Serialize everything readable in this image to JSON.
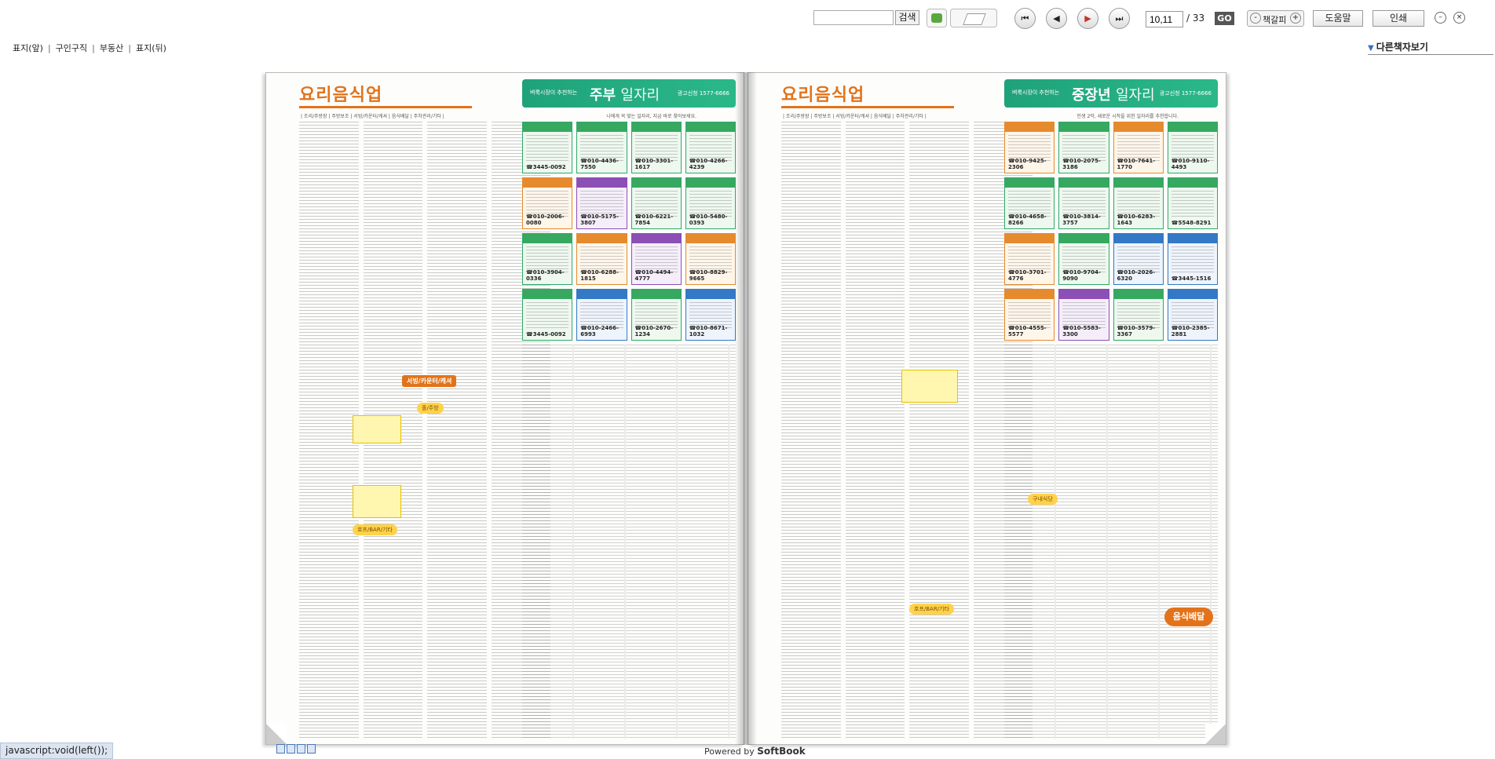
{
  "toolbar": {
    "search_placeholder": "",
    "search_label": "검색",
    "first_symbol": "⏮",
    "prev_symbol": "◀",
    "next_symbol": "▶",
    "last_symbol": "⏭",
    "page_value": "10,11",
    "page_total": "/ 33",
    "go_label": "GO",
    "zoom_minus": "-",
    "zoom_label": "책갈피",
    "zoom_plus": "+",
    "help_label": "도움말",
    "print_label": "인쇄",
    "minimize_symbol": "–",
    "close_symbol": "×"
  },
  "nav": {
    "links": [
      "표지(앞)",
      "구인구직",
      "부동산",
      "표지(뒤)"
    ],
    "other_books_label": "다른책자보기"
  },
  "left_page": {
    "title": "요리음식업",
    "sub_tabs": "| 조리/주방장 | 주방보조 | 서빙/카운터/캐셔 | 음식배달 | 주차관리/기타 |",
    "banner_small": "벼룩시장이 추천하는",
    "banner_big": "주부",
    "banner_big_light": "일자리",
    "banner_phone": "광고신청 1577-6666",
    "banner_sub": "나에게 꼭 맞는 일자리, 지금 바로 찾아보세요.",
    "label_serving": "서빙/카운터/캐셔",
    "label_hall": "홀/주방",
    "label_bar": "호프/BAR/기타",
    "box_phones": [
      "☎3445-0092",
      "☎010-4436-7550",
      "☎010-3301-1617",
      "☎010-4266-4239",
      "☎010-2006-0080",
      "☎010-5175-3807",
      "☎010-6221-7854",
      "☎010-5480-0393",
      "☎010-3904-0336",
      "☎010-6288-1815",
      "☎010-4494-4777",
      "☎010-8829-9665",
      "☎3445-0092",
      "☎010-2466-6993",
      "☎010-2670-1234",
      "☎010-8671-1032"
    ]
  },
  "right_page": {
    "title": "요리음식업",
    "sub_tabs": "| 조리/주방장 | 주방보조 | 서빙/카운터/캐셔 | 음식배달 | 주차관리/기타 |",
    "banner_small": "벼룩시장이 추천하는",
    "banner_big": "중장년",
    "banner_big_light": "일자리",
    "banner_phone": "광고신청 1577-6666",
    "banner_sub": "인생 2막, 새로운 시작을 위한 일자리를 추천합니다.",
    "label_kitchen": "구내식당",
    "label_bar": "호프/BAR/기타",
    "label_delivery": "음식배달",
    "box_phones": [
      "☎010-9425-2306",
      "☎010-2075-3186",
      "☎010-7641-1770",
      "☎010-9110-4493",
      "☎010-4658-8266",
      "☎010-3814-3757",
      "☎010-6283-1643",
      "☎5548-8291",
      "☎010-3701-4776",
      "☎010-9704-9090",
      "☎010-2026-6320",
      "☎3445-1516",
      "☎010-4555-5577",
      "☎010-5583-3300",
      "☎010-3579-3367",
      "☎010-2385-2881"
    ]
  },
  "footer": {
    "powered_prefix": "Powered by",
    "powered_brand": "SoftBook",
    "status_text": "javascript:void(left());"
  }
}
